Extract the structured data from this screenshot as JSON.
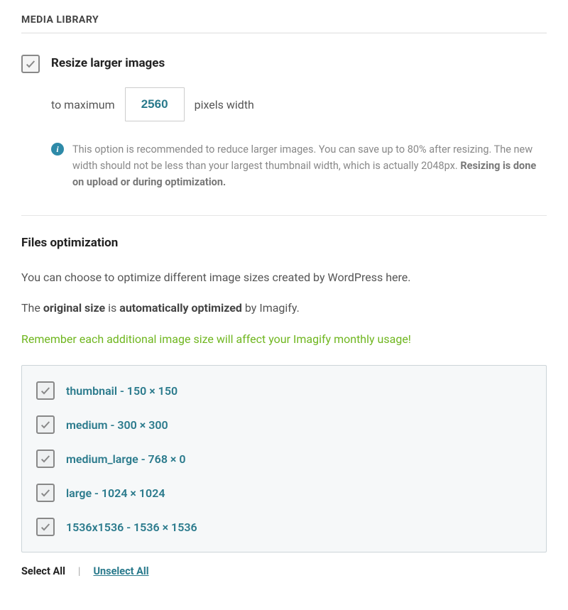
{
  "section_title": "MEDIA LIBRARY",
  "resize": {
    "label": "Resize larger images",
    "prefix": "to maximum",
    "value": "2560",
    "suffix": "pixels width",
    "info_part1": "This option is recommended to reduce larger images. You can save up to 80% after resizing. The new width should not be less than your largest thumbnail width, which is actually 2048px. ",
    "info_bold": "Resizing is done on upload or during optimization."
  },
  "files": {
    "title": "Files optimization",
    "intro": "You can choose to optimize different image sizes created by WordPress here.",
    "line2_prefix": "The ",
    "line2_strong1": "original size",
    "line2_mid": " is ",
    "line2_strong2": "automatically optimized",
    "line2_suffix": " by Imagify.",
    "warning": "Remember each additional image size will affect your Imagify monthly usage!",
    "sizes": [
      "thumbnail - 150 × 150",
      "medium - 300 × 300",
      "medium_large - 768 × 0",
      "large - 1024 × 1024",
      "1536x1536 - 1536 × 1536"
    ],
    "select_all": "Select All",
    "unselect_all": "Unselect All"
  }
}
